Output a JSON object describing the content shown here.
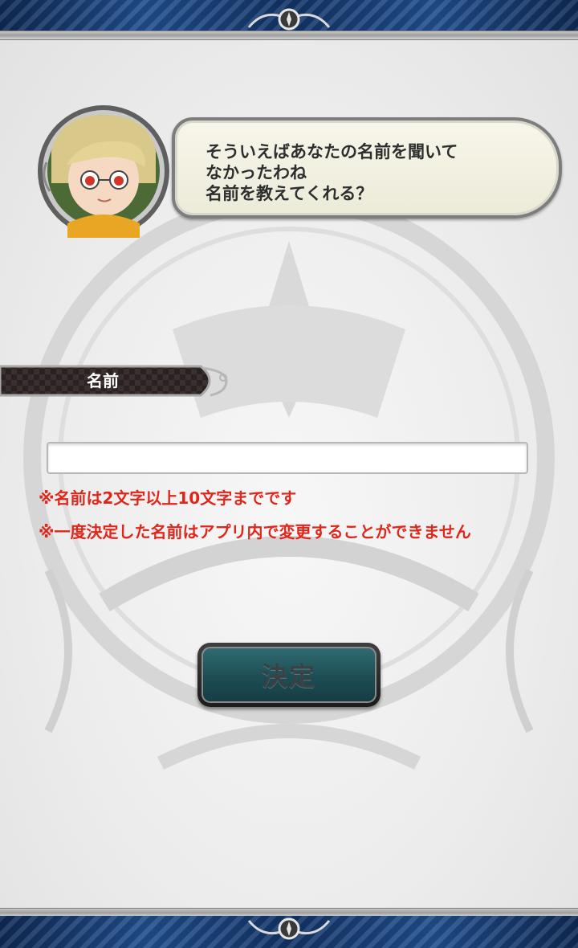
{
  "dialog": {
    "speech_text": "そういえばあなたの名前を聞いて\nなかったわね\n名前を教えてくれる？"
  },
  "form": {
    "name_label": "名前",
    "name_input_value": "",
    "notes": [
      "※名前は2文字以上10文字までです",
      "※一度決定した名前はアプリ内で変更することができません"
    ],
    "submit_label": "決定"
  },
  "colors": {
    "frame_blue": "#214f8e",
    "note_red": "#e0261b",
    "button_teal": "#1d4d54"
  },
  "icons": {
    "portrait": "character-portrait",
    "frame_ornament": "crest-ornament-icon"
  }
}
